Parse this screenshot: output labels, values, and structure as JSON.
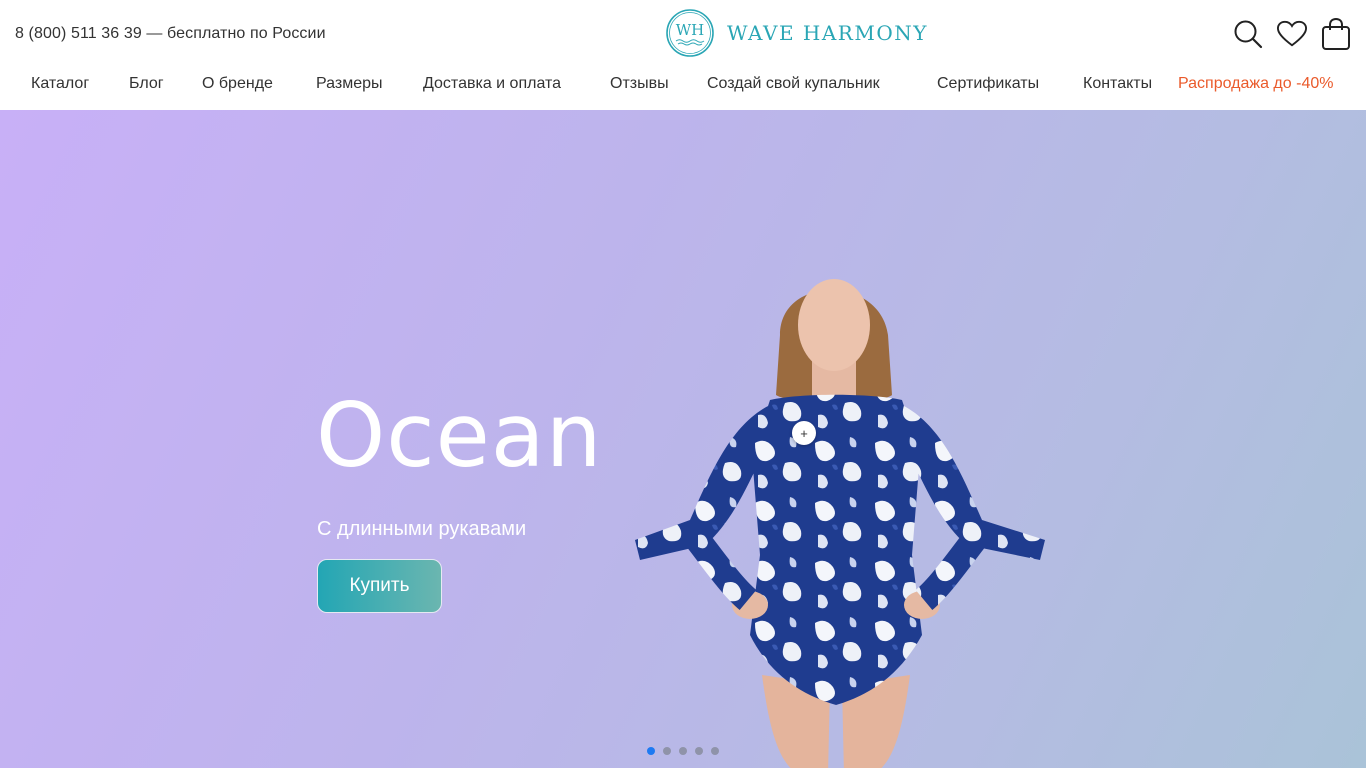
{
  "header": {
    "phone": "8 (800) 511 36 39 — бесплатно по России",
    "logo_mark": "WH",
    "logo_text": "WAVE HARMONY",
    "icons": [
      "search-icon",
      "heart-icon",
      "bag-icon"
    ]
  },
  "nav": {
    "items": [
      {
        "label": "Каталог"
      },
      {
        "label": "Блог"
      },
      {
        "label": "О бренде"
      },
      {
        "label": "Размеры"
      },
      {
        "label": "Доставка и оплата"
      },
      {
        "label": "Отзывы"
      },
      {
        "label": "Создай свой купальник"
      },
      {
        "label": "Сертификаты"
      },
      {
        "label": "Контакты"
      },
      {
        "label": "Распродажа до -40%"
      }
    ]
  },
  "hero": {
    "title": "Ocean",
    "subtitle": "С длинными рукавами",
    "button_label": "Купить",
    "hotspot_label": "+",
    "slides_total": 5,
    "active_slide": 1
  },
  "colors": {
    "accent": "#2aa6b5",
    "sale": "#ea5a2b",
    "active_dot": "#1e7af2"
  }
}
